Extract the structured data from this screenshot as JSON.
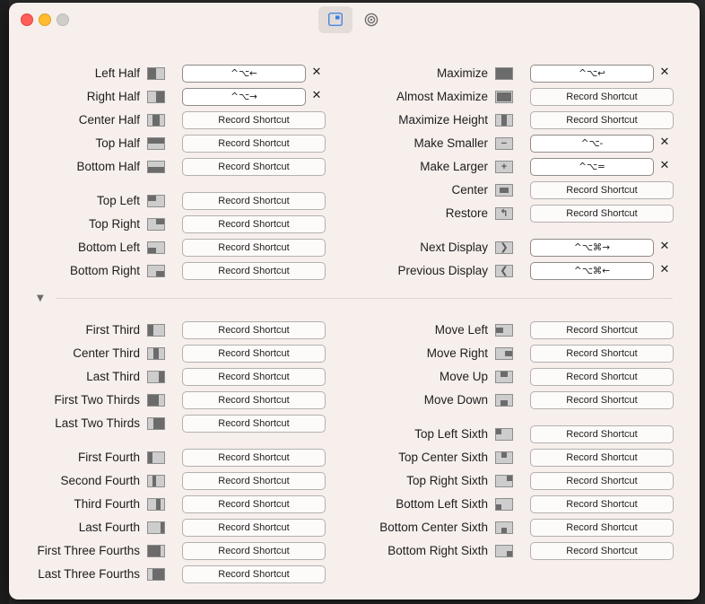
{
  "toolbar": {
    "shortcuts_tab_icon": "window-layout-icon",
    "settings_tab_icon": "gear-icon"
  },
  "clear_glyph": "✕",
  "record_label": "Record Shortcut",
  "section_toggle_glyph": "▼",
  "top_left": [
    {
      "label": "Left Half",
      "shortcut": "^⌥←"
    },
    {
      "label": "Right Half",
      "shortcut": "^⌥→"
    },
    {
      "label": "Center Half",
      "shortcut": ""
    },
    {
      "label": "Top Half",
      "shortcut": ""
    },
    {
      "label": "Bottom Half",
      "shortcut": ""
    },
    {
      "label": "Top Left",
      "shortcut": ""
    },
    {
      "label": "Top Right",
      "shortcut": ""
    },
    {
      "label": "Bottom Left",
      "shortcut": ""
    },
    {
      "label": "Bottom Right",
      "shortcut": ""
    }
  ],
  "top_right": [
    {
      "label": "Maximize",
      "shortcut": "^⌥↩"
    },
    {
      "label": "Almost Maximize",
      "shortcut": ""
    },
    {
      "label": "Maximize Height",
      "shortcut": ""
    },
    {
      "label": "Make Smaller",
      "shortcut": "^⌥-"
    },
    {
      "label": "Make Larger",
      "shortcut": "^⌥="
    },
    {
      "label": "Center",
      "shortcut": ""
    },
    {
      "label": "Restore",
      "shortcut": ""
    },
    {
      "label": "Next Display",
      "shortcut": "^⌥⌘→"
    },
    {
      "label": "Previous Display",
      "shortcut": "^⌥⌘←"
    }
  ],
  "bottom_left": [
    {
      "label": "First Third",
      "shortcut": ""
    },
    {
      "label": "Center Third",
      "shortcut": ""
    },
    {
      "label": "Last Third",
      "shortcut": ""
    },
    {
      "label": "First Two Thirds",
      "shortcut": ""
    },
    {
      "label": "Last Two Thirds",
      "shortcut": ""
    },
    {
      "label": "First Fourth",
      "shortcut": ""
    },
    {
      "label": "Second Fourth",
      "shortcut": ""
    },
    {
      "label": "Third Fourth",
      "shortcut": ""
    },
    {
      "label": "Last Fourth",
      "shortcut": ""
    },
    {
      "label": "First Three Fourths",
      "shortcut": ""
    },
    {
      "label": "Last Three Fourths",
      "shortcut": ""
    }
  ],
  "bottom_right": [
    {
      "label": "Move Left",
      "shortcut": ""
    },
    {
      "label": "Move Right",
      "shortcut": ""
    },
    {
      "label": "Move Up",
      "shortcut": ""
    },
    {
      "label": "Move Down",
      "shortcut": ""
    },
    {
      "label": "Top Left Sixth",
      "shortcut": ""
    },
    {
      "label": "Top Center Sixth",
      "shortcut": ""
    },
    {
      "label": "Top Right Sixth",
      "shortcut": ""
    },
    {
      "label": "Bottom Left Sixth",
      "shortcut": ""
    },
    {
      "label": "Bottom Center Sixth",
      "shortcut": ""
    },
    {
      "label": "Bottom Right Sixth",
      "shortcut": ""
    }
  ]
}
